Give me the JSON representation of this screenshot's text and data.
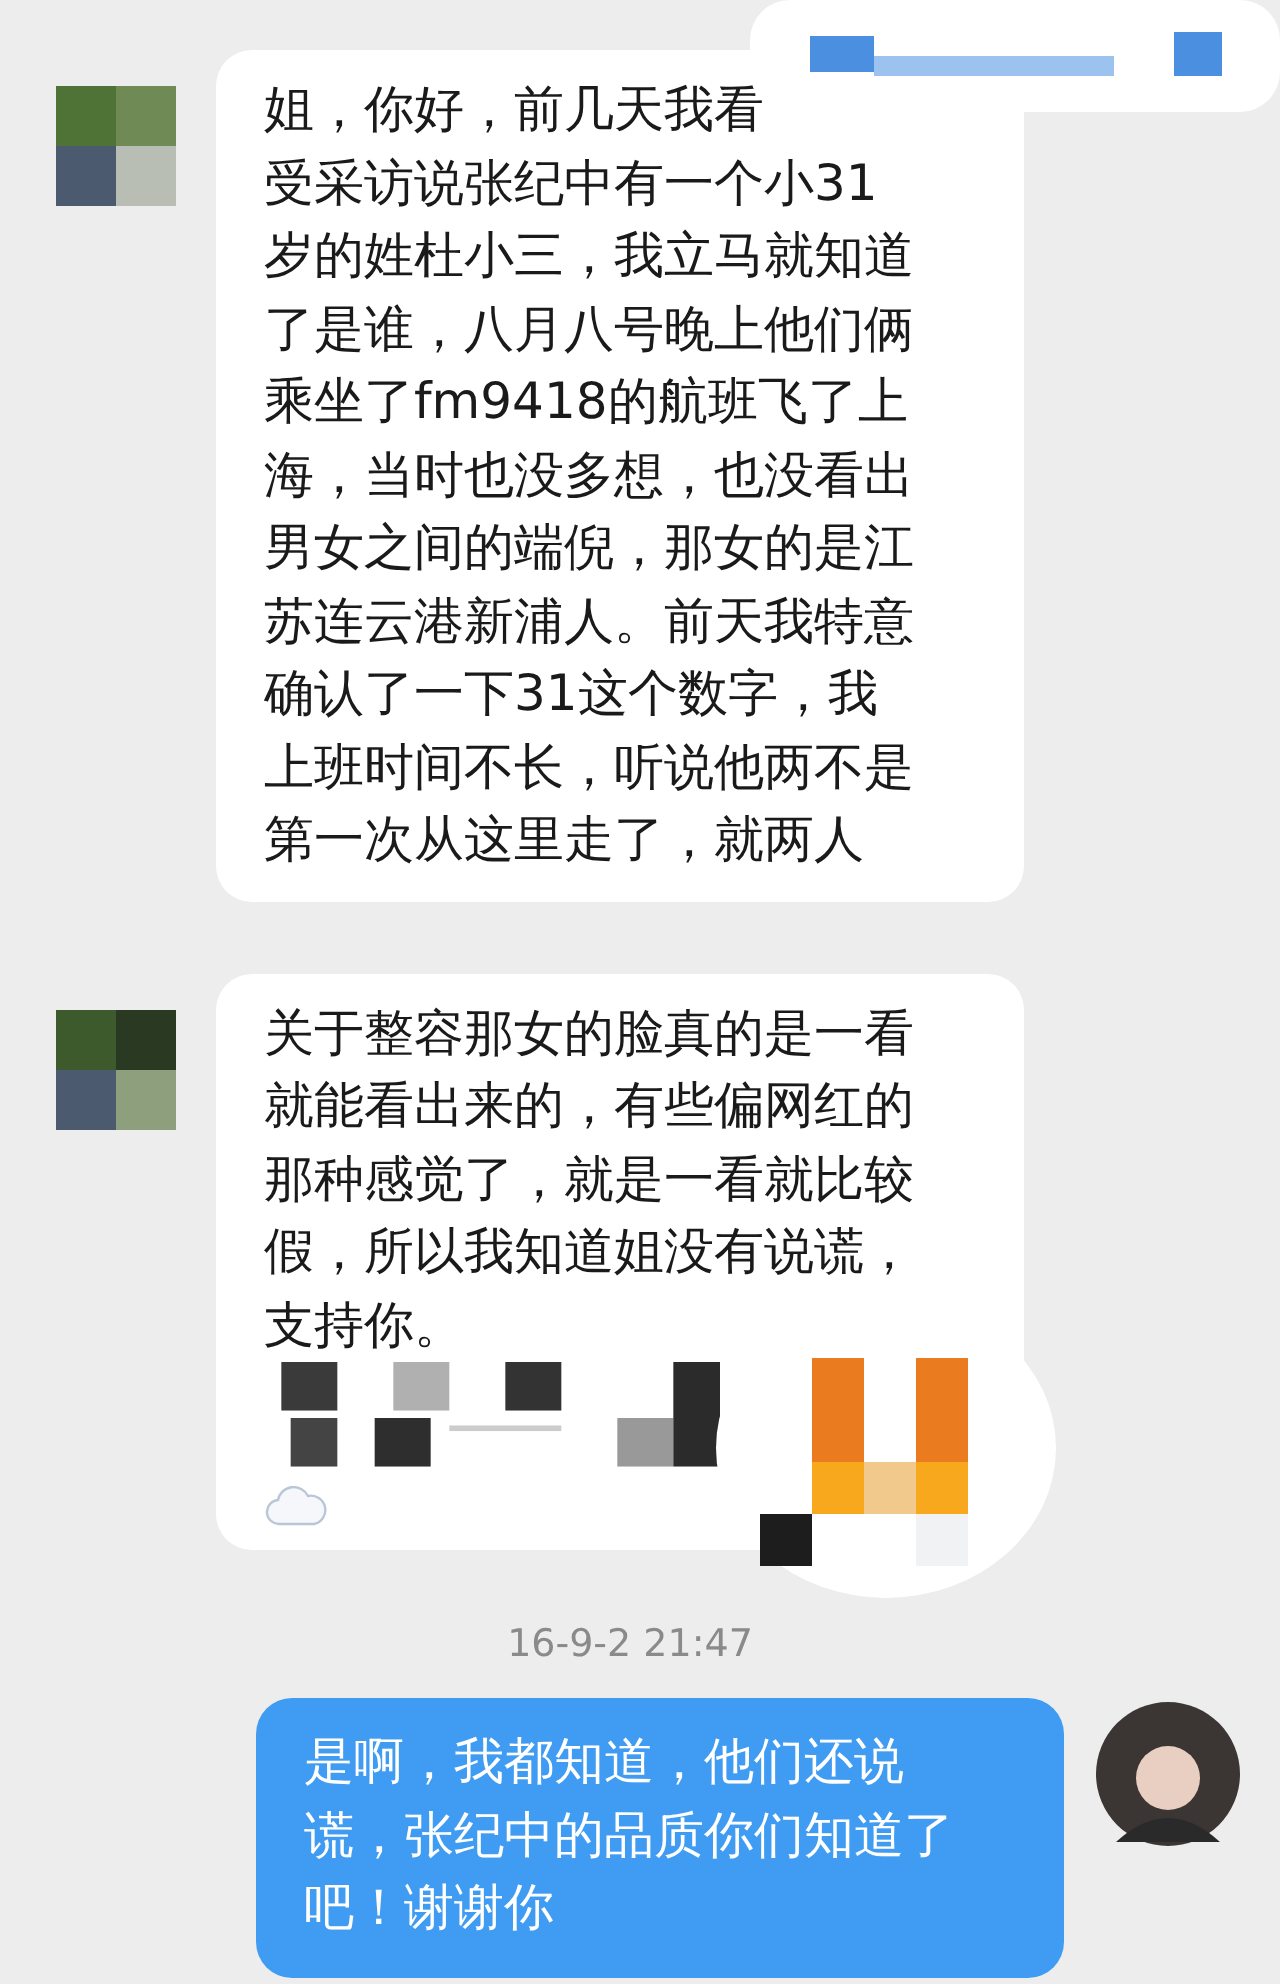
{
  "messages": [
    {
      "kind": "incoming",
      "lines": [
        "姐，你好，前几天我看",
        "受采访说张纪中有一个小31",
        "岁的姓杜小三，我立马就知道",
        "了是谁，八月八号晚上他们俩",
        "乘坐了fm9418的航班飞了上",
        "海，当时也没多想，也没看出",
        "男女之间的端倪，那女的是江",
        "苏连云港新浦人。前天我特意",
        "确认了一下31这个数字，我",
        "上班时间不长，听说他两不是",
        "第一次从这里走了，就两人"
      ]
    },
    {
      "kind": "incoming-redacted",
      "lines": [
        "关于整容那女的脸真的是一看",
        "就能看出来的，有些偏网红的",
        "那种感觉了，就是一看就比较",
        "假，所以我知道姐没有说谎，",
        "支持你。"
      ]
    },
    {
      "kind": "time",
      "text": "16-9-2 21:47"
    },
    {
      "kind": "outgoing",
      "lines": [
        "是啊，我都知道，他们还说",
        "谎，张纪中的品质你们知道了",
        "吧！谢谢你"
      ]
    }
  ]
}
